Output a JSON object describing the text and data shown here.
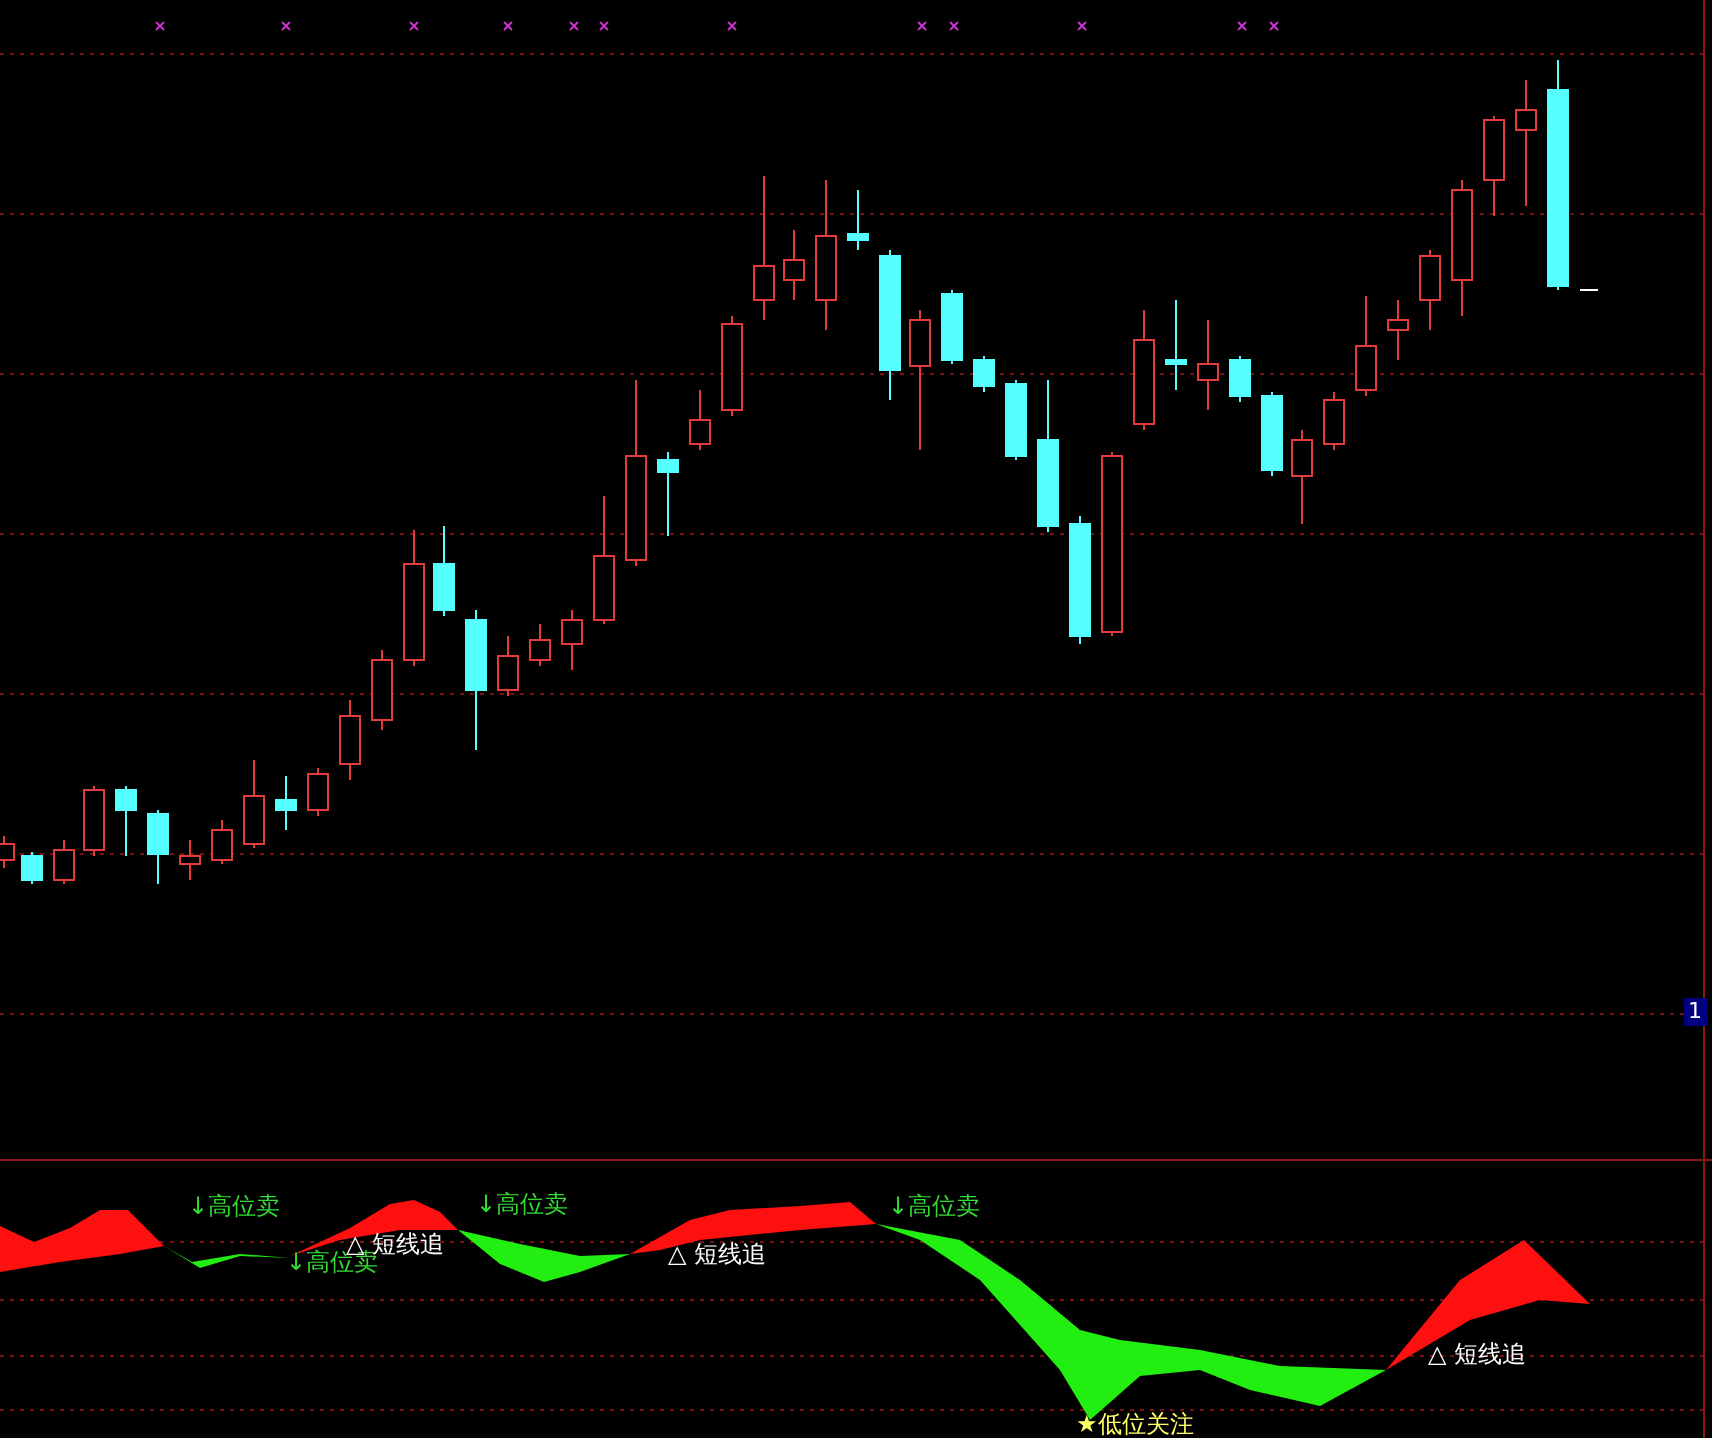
{
  "indicator_labels": [
    {
      "kind": "sell",
      "text": "↓高位卖"
    },
    {
      "kind": "sell",
      "text": "↓高位卖"
    },
    {
      "kind": "chase",
      "text": "△ 短线追"
    },
    {
      "kind": "sell",
      "text": "↓高位卖"
    },
    {
      "kind": "chase",
      "text": "△ 短线追"
    },
    {
      "kind": "sell",
      "text": "↓高位卖"
    },
    {
      "kind": "watch",
      "text": "★低位关注"
    },
    {
      "kind": "chase",
      "text": "△ 短线追"
    }
  ],
  "axis_marker": "1"
}
